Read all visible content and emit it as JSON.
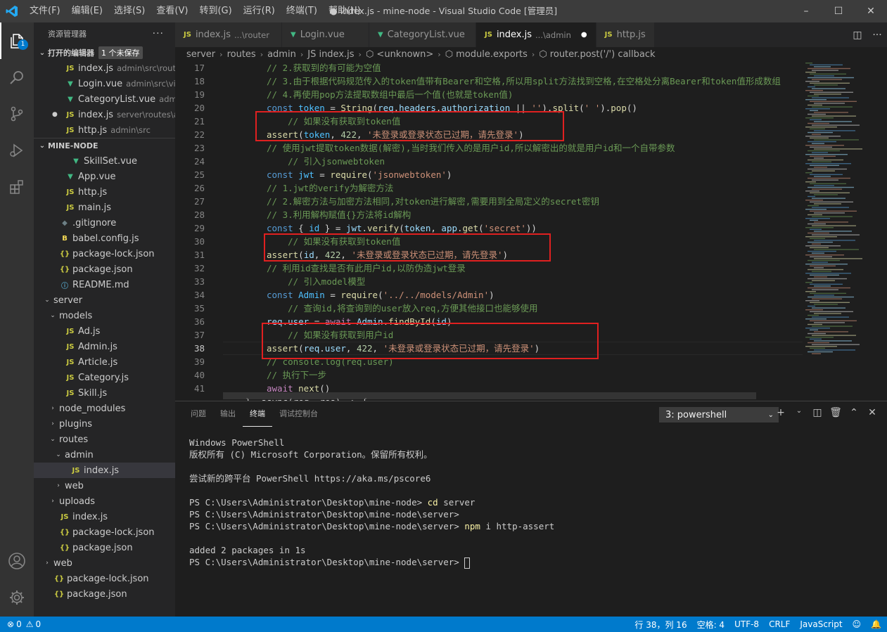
{
  "window": {
    "title": "● index.js - mine-node - Visual Studio Code [管理员]",
    "menu": [
      "文件(F)",
      "编辑(E)",
      "选择(S)",
      "查看(V)",
      "转到(G)",
      "运行(R)",
      "终端(T)",
      "帮助(H)"
    ]
  },
  "activity": {
    "explorer_badge": "1"
  },
  "sidebar": {
    "title": "资源管理器",
    "open_editors_label": "打开的编辑器",
    "unsaved_label": "1 个未保存",
    "open_editors": [
      {
        "icon": "JS",
        "name": "index.js",
        "desc": "admin\\src\\router",
        "type": "js"
      },
      {
        "icon": "▼",
        "name": "Login.vue",
        "desc": "admin\\src\\vi...",
        "type": "vue"
      },
      {
        "icon": "▼",
        "name": "CategoryList.vue",
        "desc": "admi...",
        "type": "vue"
      },
      {
        "icon": "JS",
        "name": "index.js",
        "desc": "server\\routes\\a...",
        "type": "js",
        "unsaved": true
      },
      {
        "icon": "JS",
        "name": "http.js",
        "desc": "admin\\src",
        "type": "js"
      }
    ],
    "project_label": "MINE-NODE",
    "tree": [
      {
        "name": "SkillSet.vue",
        "icon": "▼",
        "type": "vue",
        "indent": 3
      },
      {
        "name": "App.vue",
        "icon": "▼",
        "type": "vue",
        "indent": 2
      },
      {
        "name": "http.js",
        "icon": "JS",
        "type": "js",
        "indent": 2
      },
      {
        "name": "main.js",
        "icon": "JS",
        "type": "js",
        "indent": 2
      },
      {
        "name": ".gitignore",
        "icon": "◆",
        "type": "git",
        "indent": 1
      },
      {
        "name": "babel.config.js",
        "icon": "B",
        "type": "babel",
        "indent": 1
      },
      {
        "name": "package-lock.json",
        "icon": "{}",
        "type": "json",
        "indent": 1
      },
      {
        "name": "package.json",
        "icon": "{}",
        "type": "json",
        "indent": 1
      },
      {
        "name": "README.md",
        "icon": "ⓘ",
        "type": "info",
        "indent": 1
      },
      {
        "name": "server",
        "chevron": "⌄",
        "type": "folder",
        "indent": 0
      },
      {
        "name": "models",
        "chevron": "⌄",
        "type": "folder",
        "indent": 1
      },
      {
        "name": "Ad.js",
        "icon": "JS",
        "type": "js",
        "indent": 2
      },
      {
        "name": "Admin.js",
        "icon": "JS",
        "type": "js",
        "indent": 2
      },
      {
        "name": "Article.js",
        "icon": "JS",
        "type": "js",
        "indent": 2
      },
      {
        "name": "Category.js",
        "icon": "JS",
        "type": "js",
        "indent": 2
      },
      {
        "name": "Skill.js",
        "icon": "JS",
        "type": "js",
        "indent": 2
      },
      {
        "name": "node_modules",
        "chevron": "›",
        "type": "folder",
        "indent": 1
      },
      {
        "name": "plugins",
        "chevron": "›",
        "type": "folder",
        "indent": 1
      },
      {
        "name": "routes",
        "chevron": "⌄",
        "type": "folder",
        "indent": 1
      },
      {
        "name": "admin",
        "chevron": "⌄",
        "type": "folder",
        "indent": 2
      },
      {
        "name": "index.js",
        "icon": "JS",
        "type": "js",
        "indent": 3,
        "selected": true
      },
      {
        "name": "web",
        "chevron": "›",
        "type": "folder",
        "indent": 2
      },
      {
        "name": "uploads",
        "chevron": "›",
        "type": "folder",
        "indent": 1
      },
      {
        "name": "index.js",
        "icon": "JS",
        "type": "js",
        "indent": 1
      },
      {
        "name": "package-lock.json",
        "icon": "{}",
        "type": "json",
        "indent": 1
      },
      {
        "name": "package.json",
        "icon": "{}",
        "type": "json",
        "indent": 1
      },
      {
        "name": "web",
        "chevron": "›",
        "type": "folder",
        "indent": 0
      },
      {
        "name": "package-lock.json",
        "icon": "{}",
        "type": "json",
        "indent": 0
      },
      {
        "name": "package.json",
        "icon": "{}",
        "type": "json",
        "indent": 0
      }
    ]
  },
  "tabs": [
    {
      "icon": "JS",
      "name": "index.js",
      "desc": "...\\router",
      "type": "js"
    },
    {
      "icon": "▼",
      "name": "Login.vue",
      "desc": "",
      "type": "vue"
    },
    {
      "icon": "▼",
      "name": "CategoryList.vue",
      "desc": "",
      "type": "vue"
    },
    {
      "icon": "JS",
      "name": "index.js",
      "desc": "...\\admin",
      "type": "js",
      "active": true,
      "dirty": true
    },
    {
      "icon": "JS",
      "name": "http.js",
      "desc": "",
      "type": "js"
    }
  ],
  "breadcrumb": [
    "server",
    "routes",
    "admin",
    "JS index.js",
    "⬡ <unknown>",
    "⬡ module.exports",
    "⬡ router.post('/') callback"
  ],
  "editor": {
    "current_line": 38,
    "lines": [
      {
        "n": 17,
        "t": [
          [
            "c-com",
            "// 2.获取到的有可能为空值"
          ]
        ]
      },
      {
        "n": 18,
        "t": [
          [
            "c-com",
            "// 3.由于根据代码规范传入的token值带有Bearer和空格,所以用split方法找到空格,在空格处分离Bearer和token值形成数组"
          ]
        ]
      },
      {
        "n": 19,
        "t": [
          [
            "c-com",
            "// 4.再使用pop方法提取数组中最后一个值(也就是token值)"
          ]
        ]
      },
      {
        "n": 20,
        "t": [
          [
            "c-kw",
            "const "
          ],
          [
            "c-cst",
            "token"
          ],
          [
            "",
            " = "
          ],
          [
            "c-fn",
            "String"
          ],
          [
            "",
            "("
          ],
          [
            "c-var",
            "req"
          ],
          [
            "",
            "."
          ],
          [
            "c-var",
            "headers"
          ],
          [
            "",
            "."
          ],
          [
            "c-var",
            "authorization"
          ],
          [
            "",
            " || "
          ],
          [
            "c-str",
            "''"
          ],
          [
            "",
            ")."
          ],
          [
            "c-fn",
            "split"
          ],
          [
            "",
            "("
          ],
          [
            "c-str",
            "' '"
          ],
          [
            "",
            ")."
          ],
          [
            "c-fn",
            "pop"
          ],
          [
            "",
            "()"
          ]
        ]
      },
      {
        "n": 21,
        "t": [
          [
            "",
            "    "
          ],
          [
            "c-com",
            "// 如果没有获取到token值"
          ]
        ]
      },
      {
        "n": 22,
        "t": [
          [
            "c-fn",
            "assert"
          ],
          [
            "",
            "("
          ],
          [
            "c-cst",
            "token"
          ],
          [
            "",
            ", "
          ],
          [
            "c-num",
            "422"
          ],
          [
            "",
            ", "
          ],
          [
            "c-str",
            "'未登录或登录状态已过期，请先登录'"
          ],
          [
            "",
            ")"
          ]
        ]
      },
      {
        "n": 23,
        "t": [
          [
            "c-com",
            "// 使用jwt提取token数据(解密),当时我们传入的是用户id,所以解密出的就是用户id和一个自带参数"
          ]
        ]
      },
      {
        "n": 24,
        "t": [
          [
            "",
            "    "
          ],
          [
            "c-com",
            "// 引入jsonwebtoken"
          ]
        ]
      },
      {
        "n": 25,
        "t": [
          [
            "c-kw",
            "const "
          ],
          [
            "c-cst",
            "jwt"
          ],
          [
            "",
            " = "
          ],
          [
            "c-fn",
            "require"
          ],
          [
            "",
            "("
          ],
          [
            "c-str",
            "'jsonwebtoken'"
          ],
          [
            "",
            ")"
          ]
        ]
      },
      {
        "n": 26,
        "t": [
          [
            "c-com",
            "// 1.jwt的verify为解密方法"
          ]
        ]
      },
      {
        "n": 27,
        "t": [
          [
            "c-com",
            "// 2.解密方法与加密方法相同,对token进行解密,需要用到全局定义的secret密钥"
          ]
        ]
      },
      {
        "n": 28,
        "t": [
          [
            "c-com",
            "// 3.利用解构赋值{}方法将id解构"
          ]
        ]
      },
      {
        "n": 29,
        "t": [
          [
            "c-kw",
            "const "
          ],
          [
            "",
            "{ "
          ],
          [
            "c-cst",
            "id"
          ],
          [
            "",
            " } = "
          ],
          [
            "c-var",
            "jwt"
          ],
          [
            "",
            "."
          ],
          [
            "c-fn",
            "verify"
          ],
          [
            "",
            "("
          ],
          [
            "c-var",
            "token"
          ],
          [
            "",
            ", "
          ],
          [
            "c-var",
            "app"
          ],
          [
            "",
            "."
          ],
          [
            "c-fn",
            "get"
          ],
          [
            "",
            "("
          ],
          [
            "c-str",
            "'secret'"
          ],
          [
            "",
            "))"
          ]
        ]
      },
      {
        "n": 30,
        "t": [
          [
            "",
            "    "
          ],
          [
            "c-com",
            "// 如果没有获取到token值"
          ]
        ]
      },
      {
        "n": 31,
        "t": [
          [
            "c-fn",
            "assert"
          ],
          [
            "",
            "("
          ],
          [
            "c-var",
            "id"
          ],
          [
            "",
            ", "
          ],
          [
            "c-num",
            "422"
          ],
          [
            "",
            ", "
          ],
          [
            "c-str",
            "'未登录或登录状态已过期，请先登录'"
          ],
          [
            "",
            ")"
          ]
        ]
      },
      {
        "n": 32,
        "t": [
          [
            "c-com",
            "// 利用id查找是否有此用户id,以防伪造jwt登录"
          ]
        ]
      },
      {
        "n": 33,
        "t": [
          [
            "",
            "    "
          ],
          [
            "c-com",
            "// 引入model模型"
          ]
        ]
      },
      {
        "n": 34,
        "t": [
          [
            "c-kw",
            "const "
          ],
          [
            "c-cst",
            "Admin"
          ],
          [
            "",
            " = "
          ],
          [
            "c-fn",
            "require"
          ],
          [
            "",
            "("
          ],
          [
            "c-str",
            "'../../models/Admin'"
          ],
          [
            "",
            ")"
          ]
        ]
      },
      {
        "n": 35,
        "t": [
          [
            "",
            "    "
          ],
          [
            "c-com",
            "// 查询id,将查询到的user放入req,方便其他接口也能够使用"
          ]
        ]
      },
      {
        "n": 36,
        "t": [
          [
            "c-var",
            "req"
          ],
          [
            "",
            "."
          ],
          [
            "c-var",
            "user"
          ],
          [
            "",
            " = "
          ],
          [
            "c-ctl",
            "await "
          ],
          [
            "c-var",
            "Admin"
          ],
          [
            "",
            "."
          ],
          [
            "c-fn",
            "findById"
          ],
          [
            "",
            "("
          ],
          [
            "c-var",
            "id"
          ],
          [
            "",
            ")"
          ]
        ]
      },
      {
        "n": 37,
        "t": [
          [
            "",
            "    "
          ],
          [
            "c-com",
            "// 如果没有获取到用户id"
          ]
        ]
      },
      {
        "n": 38,
        "t": [
          [
            "c-fn",
            "assert"
          ],
          [
            "",
            "("
          ],
          [
            "c-var",
            "req"
          ],
          [
            "",
            "."
          ],
          [
            "c-var",
            "user"
          ],
          [
            "",
            ", "
          ],
          [
            "c-num",
            "422"
          ],
          [
            "",
            ", "
          ],
          [
            "c-str",
            "'未登录或登录状态已过期，请先登录'"
          ],
          [
            "",
            ")"
          ]
        ]
      },
      {
        "n": 39,
        "t": [
          [
            "c-com",
            "// console.log(req.user)"
          ]
        ]
      },
      {
        "n": 40,
        "t": [
          [
            "c-com",
            "// 执行下一步"
          ]
        ]
      },
      {
        "n": 41,
        "t": [
          [
            "c-ctl",
            "await "
          ],
          [
            "c-fn",
            "next"
          ],
          [
            "",
            "()"
          ]
        ]
      }
    ],
    "partial_line": "}, async(req, res) => {"
  },
  "panel": {
    "tabs": [
      "问题",
      "输出",
      "终端",
      "调试控制台"
    ],
    "active_tab": "终端",
    "terminal_select": "3: powershell",
    "terminal_lines": [
      {
        "text": "Windows PowerShell"
      },
      {
        "text": "版权所有 (C) Microsoft Corporation。保留所有权利。"
      },
      {
        "text": ""
      },
      {
        "text": "尝试新的跨平台 PowerShell https://aka.ms/pscore6"
      },
      {
        "text": ""
      },
      {
        "text": "PS C:\\Users\\Administrator\\Desktop\\mine-node> ",
        "cmd": "cd",
        "rest": " server"
      },
      {
        "text": "PS C:\\Users\\Administrator\\Desktop\\mine-node\\server>"
      },
      {
        "text": "PS C:\\Users\\Administrator\\Desktop\\mine-node\\server> ",
        "cmd": "npm",
        "rest": " i http-assert"
      },
      {
        "text": ""
      },
      {
        "text": "added 2 packages in 1s"
      },
      {
        "text": "PS C:\\Users\\Administrator\\Desktop\\mine-node\\server> ",
        "cursor": true
      }
    ]
  },
  "statusbar": {
    "errors": "0",
    "warnings": "0",
    "position": "行 38，列 16",
    "spaces": "空格: 4",
    "encoding": "UTF-8",
    "eol": "CRLF",
    "language": "JavaScript"
  }
}
